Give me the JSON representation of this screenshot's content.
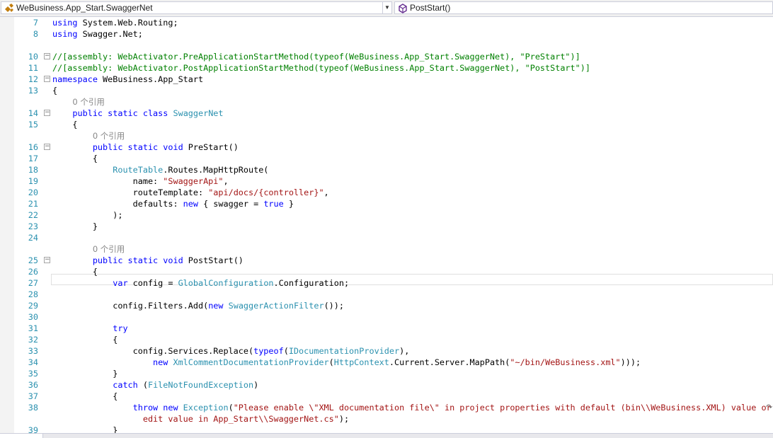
{
  "navbar": {
    "left_combo": "WeBusiness.App_Start.SwaggerNet",
    "right_combo": "PostStart()"
  },
  "codelens_text": "0 个引用",
  "lines": [
    {
      "n": "7",
      "fold": "",
      "tokens": [
        [
          "kw",
          "using"
        ],
        [
          "",
          "System.Web.Routing;"
        ]
      ]
    },
    {
      "n": "8",
      "fold": "",
      "tokens": [
        [
          "kw",
          "using"
        ],
        [
          "",
          "Swagger.Net;"
        ]
      ]
    },
    {
      "n": "",
      "fold": "",
      "tokens": []
    },
    {
      "n": "10",
      "fold": "minus",
      "tokens": [
        [
          "cm",
          "//[assembly: WebActivator.PreApplicationStartMethod(typeof(WeBusiness.App_Start.SwaggerNet), \"PreStart\")]"
        ]
      ]
    },
    {
      "n": "11",
      "fold": "",
      "tokens": [
        [
          "cm",
          "//[assembly: WebActivator.PostApplicationStartMethod(typeof(WeBusiness.App_Start.SwaggerNet), \"PostStart\")]"
        ]
      ]
    },
    {
      "n": "12",
      "fold": "minus",
      "tokens": [
        [
          "kw",
          "namespace"
        ],
        [
          "",
          "WeBusiness.App_Start"
        ]
      ]
    },
    {
      "n": "13",
      "fold": "",
      "tokens": [
        [
          "",
          "{"
        ]
      ]
    },
    {
      "n": "",
      "fold": "",
      "lens": "    ",
      "tokens": []
    },
    {
      "n": "14",
      "fold": "minus",
      "tokens": [
        [
          "",
          "    "
        ],
        [
          "kw",
          "public static class"
        ],
        [
          "ty",
          "SwaggerNet"
        ]
      ]
    },
    {
      "n": "15",
      "fold": "",
      "tokens": [
        [
          "",
          "    {"
        ]
      ]
    },
    {
      "n": "",
      "fold": "",
      "lens": "        ",
      "tokens": []
    },
    {
      "n": "16",
      "fold": "minus",
      "tokens": [
        [
          "",
          "        "
        ],
        [
          "kw",
          "public static void"
        ],
        [
          "",
          "PreStart()"
        ]
      ]
    },
    {
      "n": "17",
      "fold": "",
      "tokens": [
        [
          "",
          "        {"
        ]
      ]
    },
    {
      "n": "18",
      "fold": "",
      "tokens": [
        [
          "",
          "            "
        ],
        [
          "ty",
          "RouteTable"
        ],
        [
          "",
          ".Routes.MapHttpRoute("
        ]
      ]
    },
    {
      "n": "19",
      "fold": "",
      "tokens": [
        [
          "",
          "                name: "
        ],
        [
          "st",
          "\"SwaggerApi\""
        ],
        [
          "",
          ","
        ]
      ]
    },
    {
      "n": "20",
      "fold": "",
      "tokens": [
        [
          "",
          "                routeTemplate: "
        ],
        [
          "st",
          "\"api/docs/{controller}\""
        ],
        [
          "",
          ","
        ]
      ]
    },
    {
      "n": "21",
      "fold": "",
      "tokens": [
        [
          "",
          "                defaults: "
        ],
        [
          "kw",
          "new"
        ],
        [
          "",
          " { swagger = "
        ],
        [
          "kw",
          "true"
        ],
        [
          "",
          " }"
        ]
      ]
    },
    {
      "n": "22",
      "fold": "",
      "tokens": [
        [
          "",
          "            );"
        ]
      ]
    },
    {
      "n": "23",
      "fold": "",
      "tokens": [
        [
          "",
          "        }"
        ]
      ]
    },
    {
      "n": "24",
      "fold": "",
      "tokens": []
    },
    {
      "n": "",
      "fold": "",
      "lens": "        ",
      "tokens": []
    },
    {
      "n": "25",
      "fold": "minus",
      "tokens": [
        [
          "",
          "        "
        ],
        [
          "kw",
          "public static void"
        ],
        [
          "",
          "PostStart()"
        ]
      ]
    },
    {
      "n": "26",
      "fold": "",
      "tokens": [
        [
          "",
          "        {"
        ]
      ]
    },
    {
      "n": "27",
      "fold": "",
      "tokens": [
        [
          "",
          "            "
        ],
        [
          "kw",
          "var"
        ],
        [
          "",
          " config = "
        ],
        [
          "ty",
          "GlobalConfiguration"
        ],
        [
          "",
          ".Configuration;"
        ]
      ]
    },
    {
      "n": "28",
      "fold": "",
      "tokens": []
    },
    {
      "n": "29",
      "fold": "",
      "tokens": [
        [
          "",
          "            config.Filters.Add("
        ],
        [
          "kw",
          "new"
        ],
        [
          "",
          " "
        ],
        [
          "ty",
          "SwaggerActionFilter"
        ],
        [
          "",
          "());"
        ]
      ]
    },
    {
      "n": "30",
      "fold": "",
      "tokens": []
    },
    {
      "n": "31",
      "fold": "",
      "tokens": [
        [
          "",
          "            "
        ],
        [
          "kw",
          "try"
        ]
      ]
    },
    {
      "n": "32",
      "fold": "",
      "tokens": [
        [
          "",
          "            {"
        ]
      ]
    },
    {
      "n": "33",
      "fold": "",
      "tokens": [
        [
          "",
          "                config.Services.Replace("
        ],
        [
          "kw",
          "typeof"
        ],
        [
          "",
          "("
        ],
        [
          "ty",
          "IDocumentationProvider"
        ],
        [
          "",
          "),"
        ]
      ]
    },
    {
      "n": "34",
      "fold": "",
      "tokens": [
        [
          "",
          "                    "
        ],
        [
          "kw",
          "new"
        ],
        [
          "",
          " "
        ],
        [
          "ty",
          "XmlCommentDocumentationProvider"
        ],
        [
          "",
          "("
        ],
        [
          "ty",
          "HttpContext"
        ],
        [
          "",
          ".Current.Server.MapPath("
        ],
        [
          "st",
          "\"~/bin/WeBusiness.xml\""
        ],
        [
          "",
          ")));"
        ]
      ]
    },
    {
      "n": "35",
      "fold": "",
      "tokens": [
        [
          "",
          "            }"
        ]
      ]
    },
    {
      "n": "36",
      "fold": "",
      "tokens": [
        [
          "",
          "            "
        ],
        [
          "kw",
          "catch"
        ],
        [
          "",
          " ("
        ],
        [
          "ty",
          "FileNotFoundException"
        ],
        [
          "",
          ")"
        ]
      ]
    },
    {
      "n": "37",
      "fold": "",
      "tokens": [
        [
          "",
          "            {"
        ]
      ]
    },
    {
      "n": "38",
      "fold": "",
      "tokens": [
        [
          "",
          "                "
        ],
        [
          "kw",
          "throw new"
        ],
        [
          "",
          " "
        ],
        [
          "ty",
          "Exception"
        ],
        [
          "",
          "("
        ],
        [
          "st",
          "\"Please enable \\\"XML documentation file\\\" in project properties with default (bin\\\\WeBusiness.XML) value or"
        ]
      ]
    },
    {
      "n": "",
      "fold": "",
      "tokens": [
        [
          "st",
          "                  edit value in App_Start\\\\SwaggerNet.cs\""
        ],
        [
          "",
          ");"
        ]
      ]
    },
    {
      "n": "39",
      "fold": "",
      "tokens": [
        [
          "",
          "            }"
        ]
      ]
    }
  ]
}
